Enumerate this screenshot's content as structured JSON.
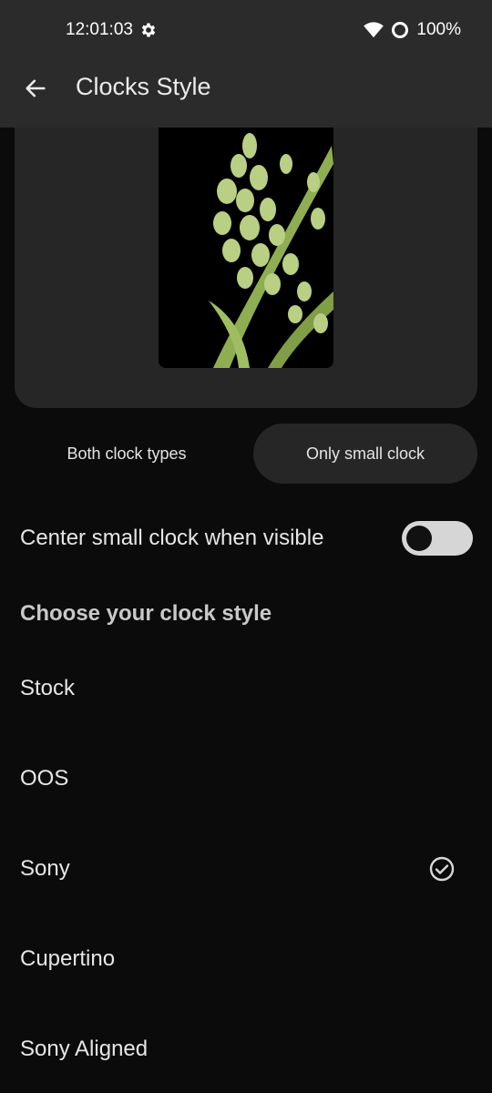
{
  "status_bar": {
    "time": "12:01:03",
    "battery": "100%",
    "icons": [
      "gear-icon",
      "wifi-icon",
      "battery-ring-icon"
    ]
  },
  "app_bar": {
    "title": "Clocks Style",
    "back_icon": "arrow-back-icon"
  },
  "clock_type": {
    "options": [
      "Both clock types",
      "Only small clock"
    ],
    "selected": "Only small clock"
  },
  "center_setting": {
    "label": "Center small clock when visible",
    "enabled": false
  },
  "section": {
    "title": "Choose your clock style"
  },
  "styles": [
    {
      "label": "Stock",
      "selected": false
    },
    {
      "label": "OOS",
      "selected": false
    },
    {
      "label": "Sony",
      "selected": true
    },
    {
      "label": "Cupertino",
      "selected": false
    },
    {
      "label": "Sony Aligned",
      "selected": false
    }
  ],
  "colors": {
    "background": "#0b0b0b",
    "surface": "#2b2b2b",
    "card": "#262626",
    "toggle_track": "#d6d6d6",
    "foliage": "#b9cf83"
  }
}
